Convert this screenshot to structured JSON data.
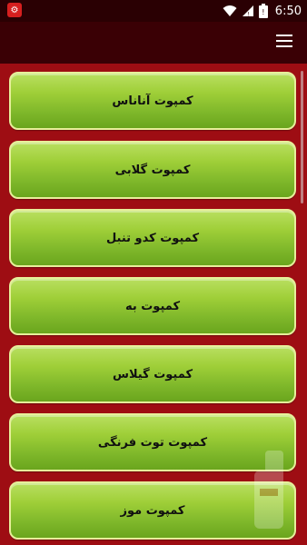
{
  "status_bar": {
    "time": "6:50",
    "app_icon_glyph": "⚙",
    "icons": [
      "app-notification-icon",
      "wifi-icon",
      "signal-icon",
      "battery-icon"
    ]
  },
  "toolbar": {
    "menu_icon": "hamburger-menu-icon"
  },
  "items": [
    {
      "label": "کمپوت آناناس"
    },
    {
      "label": "کمپوت گلابی"
    },
    {
      "label": "کمپوت کدو تنبل"
    },
    {
      "label": "کمپوت به"
    },
    {
      "label": "کمپوت گیلاس"
    },
    {
      "label": "کمپوت توت فرنگی"
    },
    {
      "label": "کمپوت موز"
    }
  ],
  "colors": {
    "background": "#9e0d13",
    "toolbar": "#3a0005",
    "status_bar": "#2a0003",
    "button_top": "#b9df60",
    "button_bottom": "#6aa51d",
    "button_border": "#e7ef9a"
  }
}
